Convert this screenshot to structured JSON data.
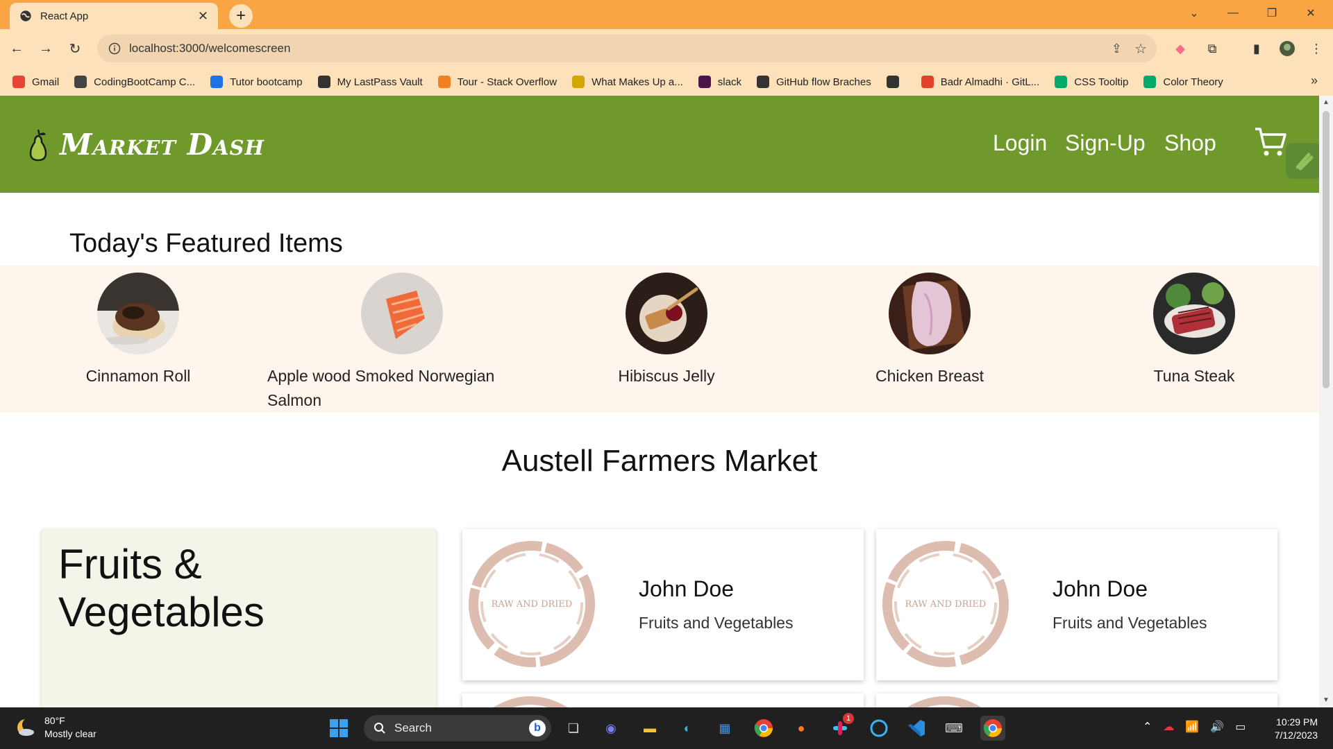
{
  "browser": {
    "tab_title": "React App",
    "url": "localhost:3000/welcomescreen",
    "bookmarks": [
      {
        "label": "Gmail",
        "icon": "gmail-icon",
        "color": "#ea4335"
      },
      {
        "label": "CodingBootCamp C...",
        "icon": "bootcamp-icon",
        "color": "#444444"
      },
      {
        "label": "Tutor bootcamp",
        "icon": "tutor-icon",
        "color": "#1a73e8"
      },
      {
        "label": "My LastPass Vault",
        "icon": "globe-icon",
        "color": "#333333"
      },
      {
        "label": "Tour - Stack Overflow",
        "icon": "stackoverflow-icon",
        "color": "#f48024"
      },
      {
        "label": "What Makes Up a...",
        "icon": "fs-icon",
        "color": "#d4a600"
      },
      {
        "label": "slack",
        "icon": "slack-icon",
        "color": "#4a154b"
      },
      {
        "label": "GitHub flow Braches",
        "icon": "github-icon",
        "color": "#333333"
      },
      {
        "label": "",
        "icon": "globe-icon",
        "color": "#333333"
      },
      {
        "label": "Badr Almadhi · GitL...",
        "icon": "gitlab-icon",
        "color": "#e24329"
      },
      {
        "label": "CSS Tooltip",
        "icon": "w3schools-icon",
        "color": "#04aa6d"
      },
      {
        "label": "Color Theory",
        "icon": "w3schools-icon",
        "color": "#04aa6d"
      }
    ]
  },
  "app": {
    "brand": "Market Dash",
    "nav": {
      "login": "Login",
      "signup": "Sign-Up",
      "shop": "Shop"
    },
    "featured_heading": "Today's Featured Items",
    "featured": [
      {
        "name": "Cinnamon Roll",
        "image": "cinnamon-roll-image"
      },
      {
        "name": "Apple wood Smoked Norwegian Salmon",
        "image": "salmon-image"
      },
      {
        "name": "Hibiscus Jelly",
        "image": "hibiscus-jelly-image"
      },
      {
        "name": "Chicken Breast",
        "image": "chicken-breast-image"
      },
      {
        "name": "Tuna Steak",
        "image": "tuna-steak-image"
      }
    ],
    "market_heading": "Austell Farmers Market",
    "category_title": "Fruits & Vegetables",
    "vendors": [
      {
        "name": "John Doe",
        "category": "Fruits and Vegetables",
        "logo_text": "RAW AND DRIED"
      },
      {
        "name": "John Doe",
        "category": "Fruits and Vegetables",
        "logo_text": "RAW AND DRIED"
      }
    ],
    "colors": {
      "nav": "#6f9a2b",
      "featured_band": "#fef5ec",
      "category_card": "#f1f6e9",
      "chat": "#6bb544"
    }
  },
  "taskbar": {
    "weather_temp": "80°F",
    "weather_desc": "Mostly clear",
    "search_label": "Search",
    "time": "10:29 PM",
    "date": "7/12/2023",
    "slack_badge": "1"
  }
}
